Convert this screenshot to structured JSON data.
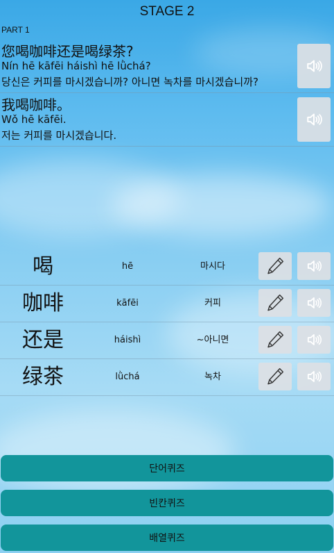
{
  "header": {
    "stage_title": "STAGE 2",
    "part_label": "PART 1"
  },
  "sentences": [
    {
      "chinese": "您喝咖啡还是喝绿茶?",
      "pinyin": "Nín hē kāfēi háishì hē lǜchá?",
      "korean": "당신은 커피를 마시겠습니까? 아니면 녹차를 마시겠습니까?",
      "audio_icon": "speaker-icon"
    },
    {
      "chinese": "我喝咖啡。",
      "pinyin": "Wǒ hē kāfēi.",
      "korean": "저는 커피를 마시겠습니다.",
      "audio_icon": "speaker-icon"
    }
  ],
  "words": [
    {
      "hanzi": "喝",
      "pinyin": "hē",
      "meaning": "마시다"
    },
    {
      "hanzi": "咖啡",
      "pinyin": "kāfēi",
      "meaning": "커피"
    },
    {
      "hanzi": "还是",
      "pinyin": "háishì",
      "meaning": "~아니면"
    },
    {
      "hanzi": "绿茶",
      "pinyin": "lǜchá",
      "meaning": "녹차"
    }
  ],
  "quiz_buttons": {
    "word_quiz": "단어퀴즈",
    "blank_quiz": "빈칸퀴즈",
    "order_quiz": "배열퀴즈"
  },
  "colors": {
    "quiz_button": "#12959b",
    "icon_button_bg": "#dce0e4",
    "sky_top": "#3aa8e6"
  }
}
